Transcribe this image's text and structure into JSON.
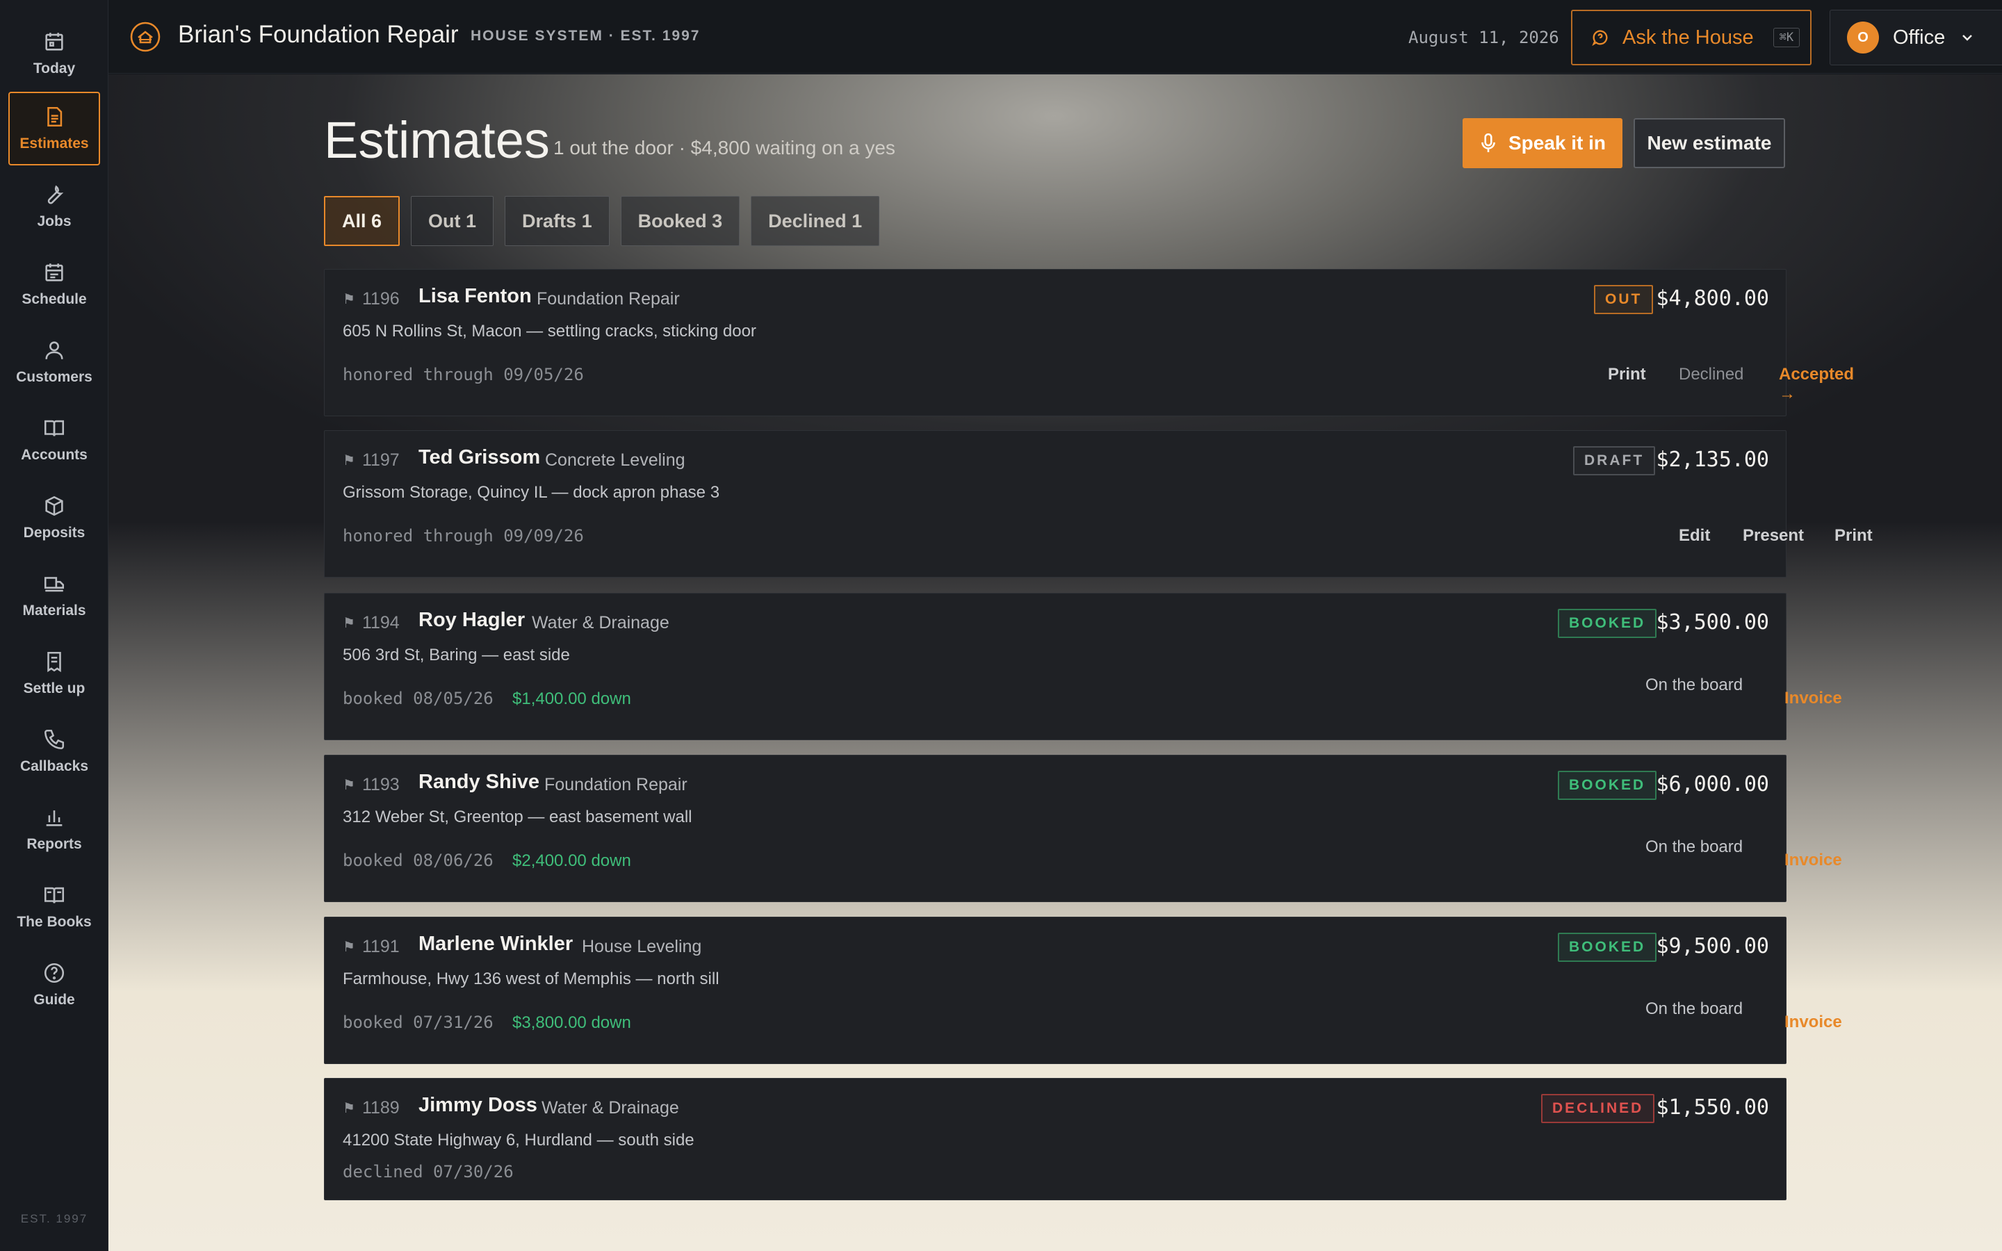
{
  "brand": {
    "name": "Brian's Foundation Repair",
    "subtitle": "HOUSE SYSTEM · EST. 1997"
  },
  "topbar": {
    "date": "August 11, 2026",
    "ask_label": "Ask the House",
    "ask_shortcut": "⌘K",
    "account_initial": "O",
    "account_label": "Office"
  },
  "sidebar": {
    "items": [
      {
        "label": "Today",
        "icon": "calendar-icon"
      },
      {
        "label": "Estimates",
        "icon": "document-icon",
        "active": true
      },
      {
        "label": "Jobs",
        "icon": "wrench-icon"
      },
      {
        "label": "Schedule",
        "icon": "calendar-grid-icon"
      },
      {
        "label": "Customers",
        "icon": "person-icon"
      },
      {
        "label": "Accounts",
        "icon": "open-book-icon"
      },
      {
        "label": "Deposits",
        "icon": "box-icon"
      },
      {
        "label": "Materials",
        "icon": "truck-icon"
      },
      {
        "label": "Settle up",
        "icon": "receipt-icon"
      },
      {
        "label": "Callbacks",
        "icon": "phone-icon"
      },
      {
        "label": "Reports",
        "icon": "bar-chart-icon"
      },
      {
        "label": "The Books",
        "icon": "book-icon"
      },
      {
        "label": "Guide",
        "icon": "help-circle-icon"
      }
    ],
    "footer": "EST. 1997"
  },
  "page": {
    "title": "Estimates",
    "subtitle": "1 out the door · $4,800 waiting on a yes",
    "speak_label": "Speak it in",
    "new_label": "New estimate"
  },
  "tabs": [
    {
      "label": "All 6",
      "active": true
    },
    {
      "label": "Out 1"
    },
    {
      "label": "Drafts 1"
    },
    {
      "label": "Booked 3"
    },
    {
      "label": "Declined 1"
    }
  ],
  "estimates": [
    {
      "number": "1196",
      "name": "Lisa Fenton",
      "type": "Foundation Repair",
      "address": "605 N Rollins St, Macon — settling cracks, sticking door",
      "status": "OUT",
      "amount": "$4,800.00",
      "meta": "honored through 09/05/26",
      "actions": [
        "Print",
        "Declined",
        "Accepted →"
      ]
    },
    {
      "number": "1197",
      "name": "Ted Grissom",
      "type": "Concrete Leveling",
      "address": "Grissom Storage, Quincy IL — dock apron phase 3",
      "status": "DRAFT",
      "amount": "$2,135.00",
      "meta": "honored through 09/09/26",
      "actions": [
        "Edit",
        "Present",
        "Print"
      ]
    },
    {
      "number": "1194",
      "name": "Roy Hagler",
      "type": "Water & Drainage",
      "address": "506 3rd St, Baring — east side",
      "status": "BOOKED",
      "amount": "$3,500.00",
      "meta": "booked 08/05/26",
      "down": "$1,400.00 down",
      "board": "On the board",
      "action": "Invoice"
    },
    {
      "number": "1193",
      "name": "Randy Shive",
      "type": "Foundation Repair",
      "address": "312 Weber St, Greentop — east basement wall",
      "status": "BOOKED",
      "amount": "$6,000.00",
      "meta": "booked 08/06/26",
      "down": "$2,400.00 down",
      "board": "On the board",
      "action": "Invoice"
    },
    {
      "number": "1191",
      "name": "Marlene Winkler",
      "type": "House Leveling",
      "address": "Farmhouse, Hwy 136 west of Memphis — north sill",
      "status": "BOOKED",
      "amount": "$9,500.00",
      "meta": "booked 07/31/26",
      "down": "$3,800.00 down",
      "board": "On the board",
      "action": "Invoice"
    },
    {
      "number": "1189",
      "name": "Jimmy Doss",
      "type": "Water & Drainage",
      "address": "41200 State Highway 6, Hurdland — south side",
      "status": "DECLINED",
      "amount": "$1,550.00",
      "meta": "declined 07/30/26"
    }
  ],
  "colors": {
    "accent": "#e8892a",
    "booked": "#3fbe7a",
    "declined": "#e0524f"
  }
}
